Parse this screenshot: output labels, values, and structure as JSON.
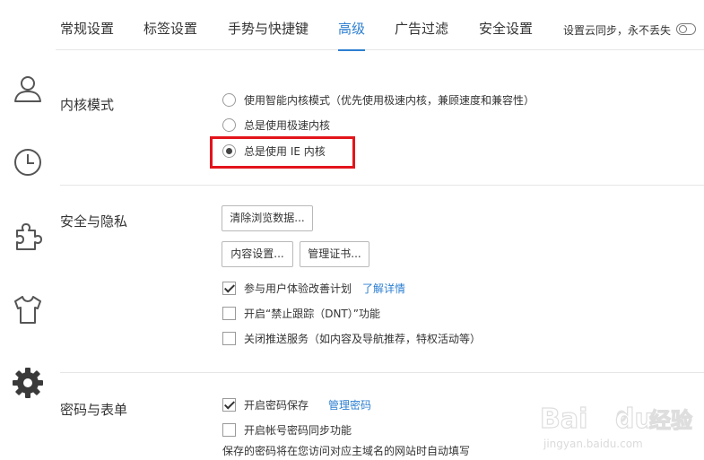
{
  "tabs": [
    {
      "label": "常规设置"
    },
    {
      "label": "标签设置"
    },
    {
      "label": "手势与快捷键"
    },
    {
      "label": "高级",
      "active": true
    },
    {
      "label": "广告过滤"
    },
    {
      "label": "安全设置"
    }
  ],
  "sync": {
    "label": "设置云同步，永不丢失",
    "enabled": false
  },
  "sidebar": {
    "icons": [
      "user-icon",
      "clock-icon",
      "puzzle-icon",
      "tshirt-icon",
      "gear-icon"
    ]
  },
  "kernel": {
    "title": "内核模式",
    "options": [
      {
        "label": "使用智能内核模式（优先使用极速内核，兼顾速度和兼容性）",
        "checked": false
      },
      {
        "label": "总是使用极速内核",
        "checked": false
      },
      {
        "label": "总是使用 IE 内核",
        "checked": true
      }
    ],
    "highlight_color": "#e3141b"
  },
  "privacy": {
    "title": "安全与隐私",
    "clear_button": "清除浏览数据...",
    "content_button": "内容设置...",
    "cert_button": "管理证书...",
    "options": [
      {
        "label": "参与用户体验改善计划",
        "checked": true,
        "link": "了解详情"
      },
      {
        "label": "开启“禁止跟踪（DNT）”功能",
        "checked": false
      },
      {
        "label": "关闭推送服务（如内容及导航推荐，特权活动等）",
        "checked": false
      }
    ]
  },
  "password": {
    "title": "密码与表单",
    "options": [
      {
        "label": "开启密码保存",
        "checked": true,
        "link": "管理密码"
      },
      {
        "label": "开启帐号密码同步功能",
        "checked": false
      }
    ],
    "note": "保存的密码将在您访问对应主域名的网站时自动填写"
  },
  "watermark": {
    "brand": "Bai",
    "brand2": "du",
    "suffix": "经验",
    "url": "jingyan.baidu.com"
  },
  "colors": {
    "accent": "#2d7fd1",
    "highlight": "#e3141b"
  }
}
